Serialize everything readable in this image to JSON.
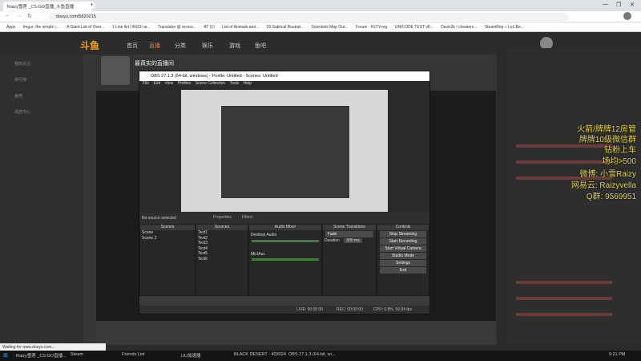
{
  "browser": {
    "active_tab": "Raizy雪莲 _CS:GO直播_斗鱼直播",
    "url": "douyu.com/5820215",
    "bookmarks": [
      "Apps",
      "Imgur: the simple i...",
      "A Giant List of Over...",
      "1 Line Art | ASCII ar...",
      "Translator @ econo...",
      "AT (1)",
      "List of Animals and...",
      "20 Satirical Illustrat...",
      "Scientists Map Out...",
      "Forum - HLTV.org",
      "UNICODE TEST v8...",
      "Davis2k / cheaters...",
      "SteamRep » LoL Bo..."
    ]
  },
  "site": {
    "logo": "斗鱼",
    "nav": [
      "首页",
      "直播",
      "分类",
      "娱乐",
      "游戏",
      "鱼吧"
    ],
    "room_title": "最真实的直播间",
    "left_menu": [
      "我的关注",
      "排行榜",
      "鱼吧",
      "消息中心"
    ],
    "overlay_text": [
      "火箭/牌牌12房管",
      "牌牌10级微信群",
      "钻粉上车",
      "场均>500",
      "微博: 小雪Raizy",
      "网易云: Raizyvella",
      "Q群: 9569951"
    ]
  },
  "obs": {
    "title": "OBS 27.1.3 (64-bit, windows) - Profile: Untitled - Scenes: Untitled",
    "menu": [
      "File",
      "Edit",
      "View",
      "Profiles",
      "Scene Collection",
      "Tools",
      "Help"
    ],
    "no_source": "No source selected",
    "properties": "Properties",
    "filters": "Filters",
    "docks": {
      "scenes": {
        "label": "Scenes",
        "items": [
          "Scene",
          "Scene 2"
        ]
      },
      "sources": {
        "label": "Sources",
        "items": [
          "Text1",
          "Text2",
          "Text3",
          "Text4",
          "Text5",
          "Text6"
        ]
      },
      "mixer": {
        "label": "Audio Mixer",
        "channels": [
          "Desktop Audio",
          "Mic/Aux"
        ]
      },
      "transitions": {
        "label": "Scene Transitions",
        "type": "Fade",
        "duration_label": "Duration",
        "duration": "300 ms"
      },
      "controls": {
        "label": "Controls",
        "buttons": [
          "Stop Streaming",
          "Start Recording",
          "Start Virtual Camera",
          "Studio Mode",
          "Settings",
          "Exit"
        ]
      }
    },
    "status": {
      "live": "LIVE: 00:00:00",
      "rec": "REC: 00:00:00",
      "cpu": "CPU: 0.8%, 59.94 fps"
    }
  },
  "statusbar": "Waiting for www.douyu.com...",
  "taskbar": {
    "items": [
      "Raizy雪莲 _CS:GO直播...",
      "Steam",
      "Friends List",
      "UU加速器",
      "BLACK DESERT - 403024",
      "OBS 27.1.3 (64-bit, wi..."
    ],
    "clock": "9:21 PM"
  }
}
